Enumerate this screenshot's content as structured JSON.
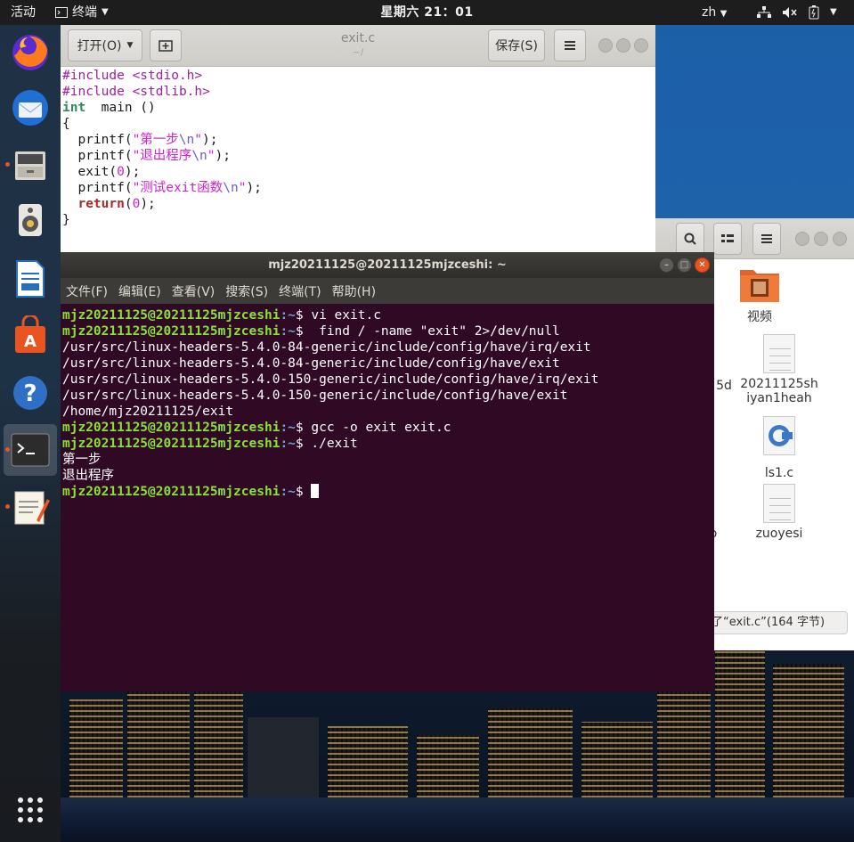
{
  "topbar": {
    "activities": "活动",
    "app_name": "终端",
    "clock": "星期六 21：01",
    "input_lang": "zh"
  },
  "dock": {
    "items": [
      "firefox-icon",
      "thunderbird-icon",
      "file-cabinet-icon",
      "speaker-icon",
      "writer-icon",
      "software-bag-icon",
      "help-icon",
      "terminal-icon",
      "text-editor-icon",
      "app-grid-icon"
    ]
  },
  "gedit": {
    "open_label": "打开(O)",
    "title": "exit.c",
    "subtitle": "~/",
    "save_label": "保存(S)",
    "code_lines": [
      [
        [
          "pp",
          "#include "
        ],
        [
          "pp",
          "<stdio.h>"
        ]
      ],
      [
        [
          "pp",
          "#include "
        ],
        [
          "pp",
          "<stdlib.h>"
        ]
      ],
      [
        [
          "kw",
          "int"
        ],
        [
          "",
          "  main ()"
        ]
      ],
      [
        [
          "",
          "{"
        ]
      ],
      [
        [
          "",
          "  printf("
        ],
        [
          "str",
          "\"第一步"
        ],
        [
          "esc",
          "\\n"
        ],
        [
          "str",
          "\""
        ],
        [
          "",
          ");"
        ]
      ],
      [
        [
          "",
          "  printf("
        ],
        [
          "str",
          "\"退出程序"
        ],
        [
          "esc",
          "\\n"
        ],
        [
          "str",
          "\""
        ],
        [
          "",
          ");"
        ]
      ],
      [
        [
          "",
          "  exit("
        ],
        [
          "num",
          "0"
        ],
        [
          "",
          ");"
        ]
      ],
      [
        [
          "",
          "  printf("
        ],
        [
          "str",
          "\"测试exit函数"
        ],
        [
          "esc",
          "\\n"
        ],
        [
          "str",
          "\""
        ],
        [
          "",
          ");"
        ]
      ],
      [
        [
          "ret",
          "  return"
        ],
        [
          "",
          "("
        ],
        [
          "num",
          "0"
        ],
        [
          "",
          ");"
        ]
      ],
      [
        [
          "",
          "}"
        ]
      ]
    ]
  },
  "files": {
    "items": [
      {
        "label": "视频",
        "icon": "video-folder-icon"
      },
      {
        "label": "20211125sh\niyan1heah",
        "icon": "text-file-icon"
      },
      {
        "label": "ls1.c",
        "icon": "c-source-icon"
      },
      {
        "label": "zuoyesi",
        "icon": "text-file-icon"
      }
    ],
    "partial_left_1": "5d",
    "partial_left_2": "o",
    "status": "了“exit.c”(164 字节)"
  },
  "terminal": {
    "title": "mjz20211125@20211125mjzceshi: ~",
    "menu": [
      "文件(F)",
      "编辑(E)",
      "查看(V)",
      "搜索(S)",
      "终端(T)",
      "帮助(H)"
    ],
    "prompt_user": "mjz20211125@20211125mjzceshi",
    "prompt_path": ":~",
    "lines": [
      {
        "type": "cmd",
        "text": "$ vi exit.c"
      },
      {
        "type": "cmd",
        "text": "$  find / -name \"exit\" 2>/dev/null"
      },
      {
        "type": "out",
        "text": "/usr/src/linux-headers-5.4.0-84-generic/include/config/have/irq/exit"
      },
      {
        "type": "out",
        "text": "/usr/src/linux-headers-5.4.0-84-generic/include/config/have/exit"
      },
      {
        "type": "out",
        "text": "/usr/src/linux-headers-5.4.0-150-generic/include/config/have/irq/exit"
      },
      {
        "type": "out",
        "text": "/usr/src/linux-headers-5.4.0-150-generic/include/config/have/exit"
      },
      {
        "type": "out",
        "text": "/home/mjz20211125/exit"
      },
      {
        "type": "cmd",
        "text": "$ gcc -o exit exit.c"
      },
      {
        "type": "cmd",
        "text": "$ ./exit"
      },
      {
        "type": "out",
        "text": "第一步"
      },
      {
        "type": "out",
        "text": "退出程序"
      },
      {
        "type": "cursor",
        "text": "$ "
      }
    ]
  }
}
